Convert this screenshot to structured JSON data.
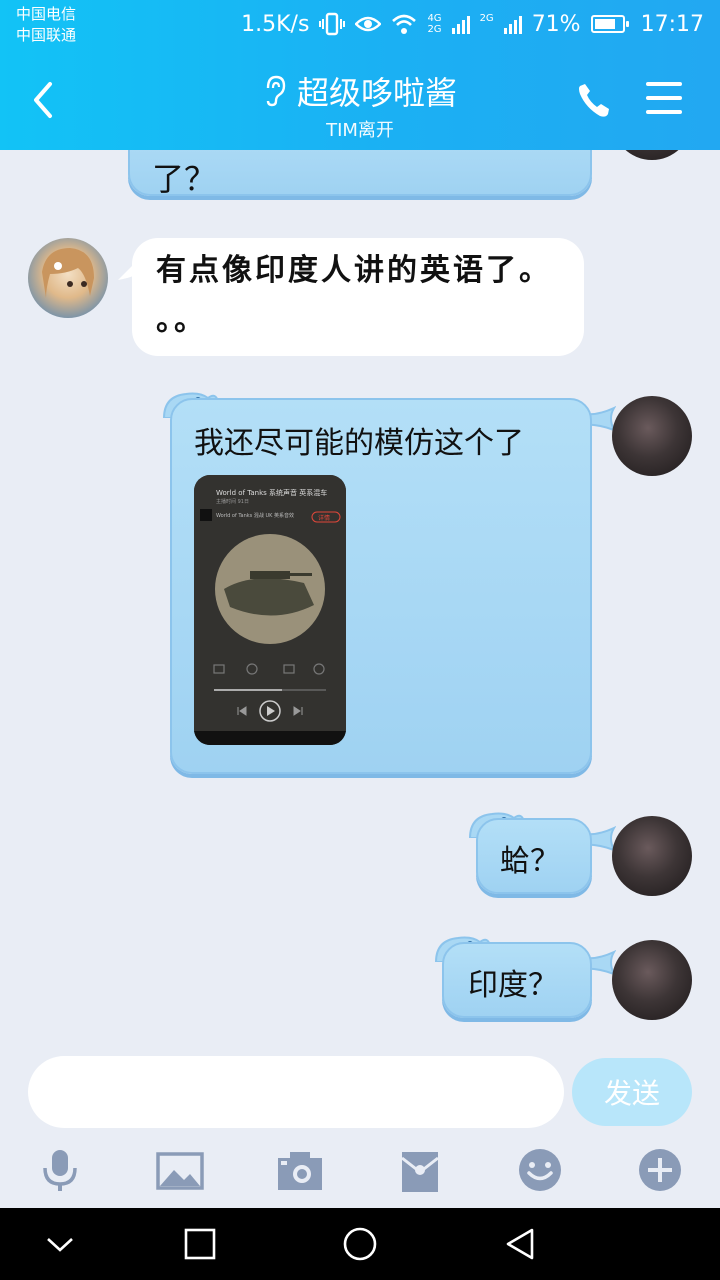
{
  "status_bar": {
    "carrier_1": "中国电信",
    "carrier_2": "中国联通",
    "speed": "1.5K/s",
    "net_1": "4G",
    "net_2": "2G",
    "net_3": "2G",
    "battery": "71%",
    "time": "17:17"
  },
  "header": {
    "title": "超级哆啦酱",
    "subtitle": "TIM离开"
  },
  "messages": [
    {
      "side": "right",
      "text": "了？"
    },
    {
      "side": "left",
      "text_line1": "有点像印度人讲的英语了。",
      "text_line2": "。。"
    },
    {
      "side": "right",
      "text": "我还尽可能的模仿这个了"
    },
    {
      "side": "right",
      "text": "蛤？"
    },
    {
      "side": "right",
      "text": "印度？"
    }
  ],
  "shared_screenshot": {
    "title": "World of Tanks 系统声音 英系混车",
    "subtitle": "主播时间 91日",
    "track": "World of Tanks 混战 UK 英系音效",
    "badge": "详情"
  },
  "input": {
    "placeholder": "",
    "send_label": "发送"
  },
  "icons": {
    "toolbar": [
      "microphone-icon",
      "image-icon",
      "camera-icon",
      "red-packet-icon",
      "emoji-icon",
      "plus-icon"
    ],
    "navbar": [
      "collapse-icon",
      "recents-icon",
      "home-icon",
      "back-icon"
    ]
  },
  "colors": {
    "header": "#1bb0f3",
    "bubble": "#a9d8f4",
    "background": "#e9edf5",
    "send": "#b8e6fa",
    "toolbar_icon": "#8a9bb7"
  }
}
